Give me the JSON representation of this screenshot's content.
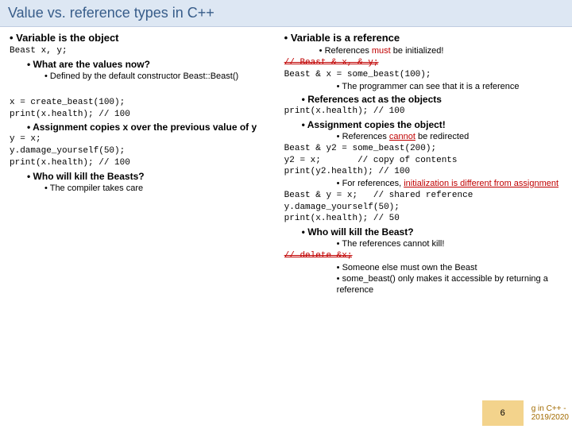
{
  "title": "Value vs. reference types in C++",
  "left": {
    "h1": "Variable is the object",
    "code1": "Beast x, y;",
    "q1": "What are the values now?",
    "a1": "Defined by the default constructor Beast::Beast()",
    "code2a": "x = create_beast(100);",
    "code2b": "print(x.health); // 100",
    "assign": "Assignment copies x over the previous value of y",
    "code3a": "y = x;",
    "code3b": "y.damage_yourself(50);",
    "code3c": "print(x.health); // 100",
    "kill": "Who will kill the Beasts?",
    "killA": "The compiler takes care"
  },
  "right": {
    "h1": "Variable is a reference",
    "mustInit1": "References ",
    "mustInit2": "must",
    "mustInit3": " be initialized!",
    "code1": "// Beast & x, & y;",
    "code2": "Beast & x = some_beast(100);",
    "pt1": "The programmer can see that it is a reference",
    "refAct": "References act as the objects",
    "code3": "print(x.health); // 100",
    "assignCopy": "Assignment copies the object!",
    "noRedir1": "References ",
    "noRedir2": "cannot",
    "noRedir3": " be redirected",
    "code4a": "Beast & y2 = some_beast(200);",
    "code4b": "y2 = x;       // copy of contents",
    "code4c": "print(y2.health); // 100",
    "initDiff1": "For references, ",
    "initDiff2": "initialization is different from assignment",
    "code5a": "Beast & y = x;   // shared reference",
    "code5b": "y.damage_yourself(50);",
    "code5c": "print(x.health); // 50",
    "kill": "Who will kill the Beast?",
    "noKill": "The references cannot kill!",
    "code6": "// delete &x;",
    "own": "Someone else must own the Beast",
    "sb": "some_beast() only makes it accessible by returning a reference"
  },
  "footer": {
    "num": "6",
    "cap1": "g in C++ -",
    "cap2": "2019/2020"
  }
}
